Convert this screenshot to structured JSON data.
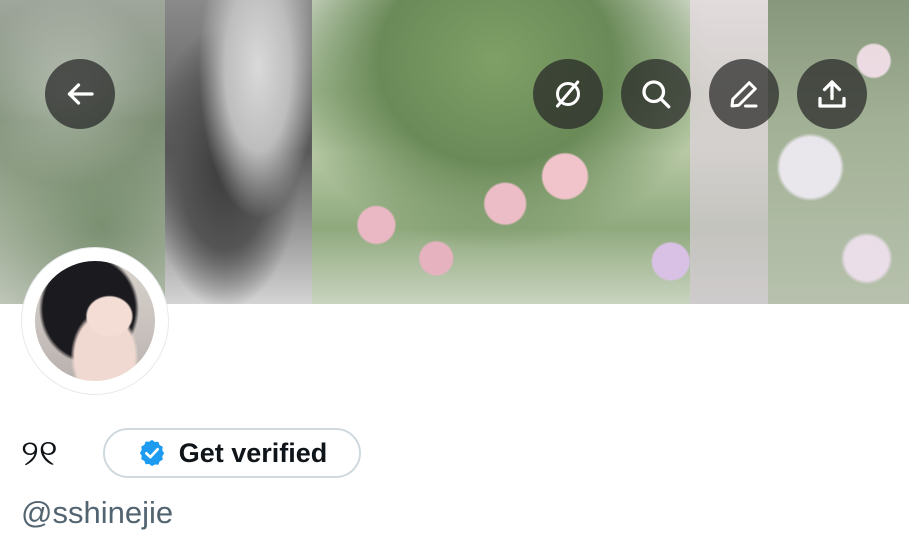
{
  "profile": {
    "display_name": "୨୧",
    "handle": "@sshinejie",
    "verify_button_label": "Get verified"
  },
  "icons": {
    "back": "arrow-left-icon",
    "grok": "grok-icon",
    "search": "search-icon",
    "edit": "edit-icon",
    "share": "share-icon",
    "verified": "verified-badge-icon"
  },
  "colors": {
    "verified_blue": "#1d9bf0",
    "text_primary": "#0f1419",
    "text_secondary": "#536471",
    "button_border": "#cfd9de",
    "overlay_button": "#262626"
  }
}
